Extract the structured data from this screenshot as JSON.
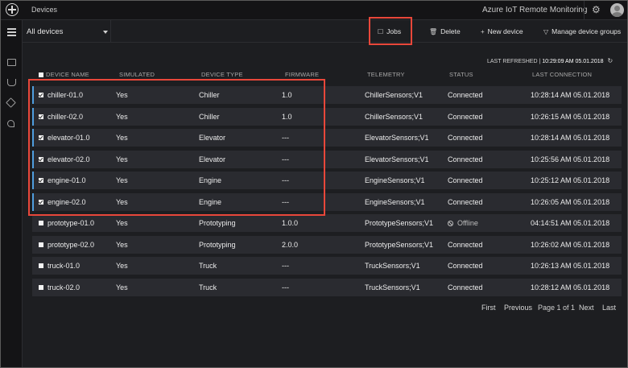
{
  "topbar": {
    "breadcrumb": "Devices",
    "app_name": "Azure IoT Remote Monitoring",
    "settings_icon": "gear-icon",
    "avatar_icon": "user-avatar-icon"
  },
  "toolbar": {
    "filter_value": "All devices",
    "jobs_label": "Jobs",
    "delete_label": "Delete",
    "new_device_label": "New device",
    "manage_groups_label": "Manage device groups"
  },
  "refresh": {
    "label": "LAST REFRESHED |",
    "time": "10:29:09 AM 05.01.2018"
  },
  "table": {
    "headers": [
      "DEVICE NAME",
      "SIMULATED",
      "DEVICE TYPE",
      "FIRMWARE",
      "TELEMETRY",
      "STATUS",
      "LAST CONNECTION"
    ],
    "rows": [
      {
        "name": "chiller-01.0",
        "simulated": "Yes",
        "type": "Chiller",
        "firmware": "1.0",
        "telemetry": "ChillerSensors;V1",
        "status": "Connected",
        "last": "10:28:14 AM 05.01.2018",
        "selected": true
      },
      {
        "name": "chiller-02.0",
        "simulated": "Yes",
        "type": "Chiller",
        "firmware": "1.0",
        "telemetry": "ChillerSensors;V1",
        "status": "Connected",
        "last": "10:26:15 AM 05.01.2018",
        "selected": true
      },
      {
        "name": "elevator-01.0",
        "simulated": "Yes",
        "type": "Elevator",
        "firmware": "---",
        "telemetry": "ElevatorSensors;V1",
        "status": "Connected",
        "last": "10:28:14 AM 05.01.2018",
        "selected": true
      },
      {
        "name": "elevator-02.0",
        "simulated": "Yes",
        "type": "Elevator",
        "firmware": "---",
        "telemetry": "ElevatorSensors;V1",
        "status": "Connected",
        "last": "10:25:56 AM 05.01.2018",
        "selected": true
      },
      {
        "name": "engine-01.0",
        "simulated": "Yes",
        "type": "Engine",
        "firmware": "---",
        "telemetry": "EngineSensors;V1",
        "status": "Connected",
        "last": "10:25:12 AM 05.01.2018",
        "selected": true
      },
      {
        "name": "engine-02.0",
        "simulated": "Yes",
        "type": "Engine",
        "firmware": "---",
        "telemetry": "EngineSensors;V1",
        "status": "Connected",
        "last": "10:26:05 AM 05.01.2018",
        "selected": true
      },
      {
        "name": "prototype-01.0",
        "simulated": "Yes",
        "type": "Prototyping",
        "firmware": "1.0.0",
        "telemetry": "PrototypeSensors;V1",
        "status": "Offline",
        "last": "04:14:51 AM 05.01.2018",
        "selected": false
      },
      {
        "name": "prototype-02.0",
        "simulated": "Yes",
        "type": "Prototyping",
        "firmware": "2.0.0",
        "telemetry": "PrototypeSensors;V1",
        "status": "Connected",
        "last": "10:26:02 AM 05.01.2018",
        "selected": false
      },
      {
        "name": "truck-01.0",
        "simulated": "Yes",
        "type": "Truck",
        "firmware": "---",
        "telemetry": "TruckSensors;V1",
        "status": "Connected",
        "last": "10:26:13 AM 05.01.2018",
        "selected": false
      },
      {
        "name": "truck-02.0",
        "simulated": "Yes",
        "type": "Truck",
        "firmware": "---",
        "telemetry": "TruckSensors;V1",
        "status": "Connected",
        "last": "10:28:12 AM 05.01.2018",
        "selected": false
      }
    ]
  },
  "pager": {
    "first": "First",
    "previous": "Previous",
    "page_info": "Page 1 of 1",
    "next": "Next",
    "last": "Last"
  },
  "colors": {
    "background": "#1d1e21",
    "row": "#2a2b30",
    "selection_accent": "#4f9ede",
    "highlight": "#e8473a"
  }
}
